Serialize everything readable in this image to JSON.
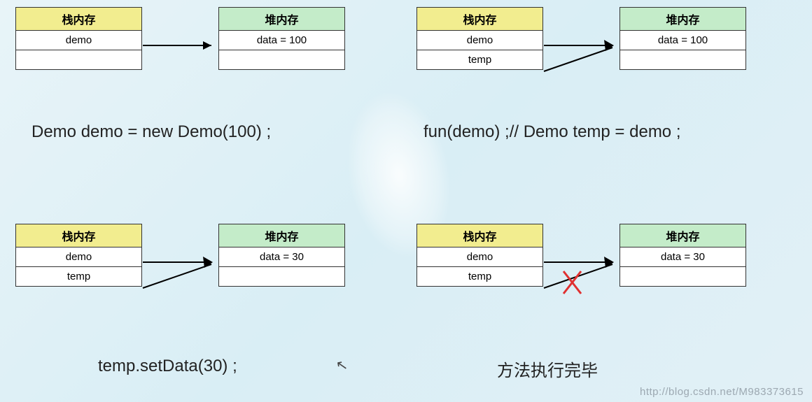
{
  "labels": {
    "stack_memory": "栈内存",
    "heap_memory": "堆内存"
  },
  "panels": {
    "p1": {
      "stack_rows": [
        "demo",
        ""
      ],
      "heap_rows": [
        "data = 100",
        ""
      ],
      "caption": "Demo demo = new Demo(100) ;"
    },
    "p2": {
      "stack_rows": [
        "demo",
        "temp"
      ],
      "heap_rows": [
        "data = 100",
        ""
      ],
      "caption": "fun(demo) ;// Demo temp = demo ;"
    },
    "p3": {
      "stack_rows": [
        "demo",
        "temp"
      ],
      "heap_rows": [
        "data = 30",
        ""
      ],
      "caption": "temp.setData(30) ;"
    },
    "p4": {
      "stack_rows": [
        "demo",
        "temp"
      ],
      "heap_rows": [
        "data = 30",
        ""
      ],
      "caption": "方法执行完毕",
      "temp_deleted": true
    }
  },
  "watermark": "http://blog.csdn.net/M983373615"
}
